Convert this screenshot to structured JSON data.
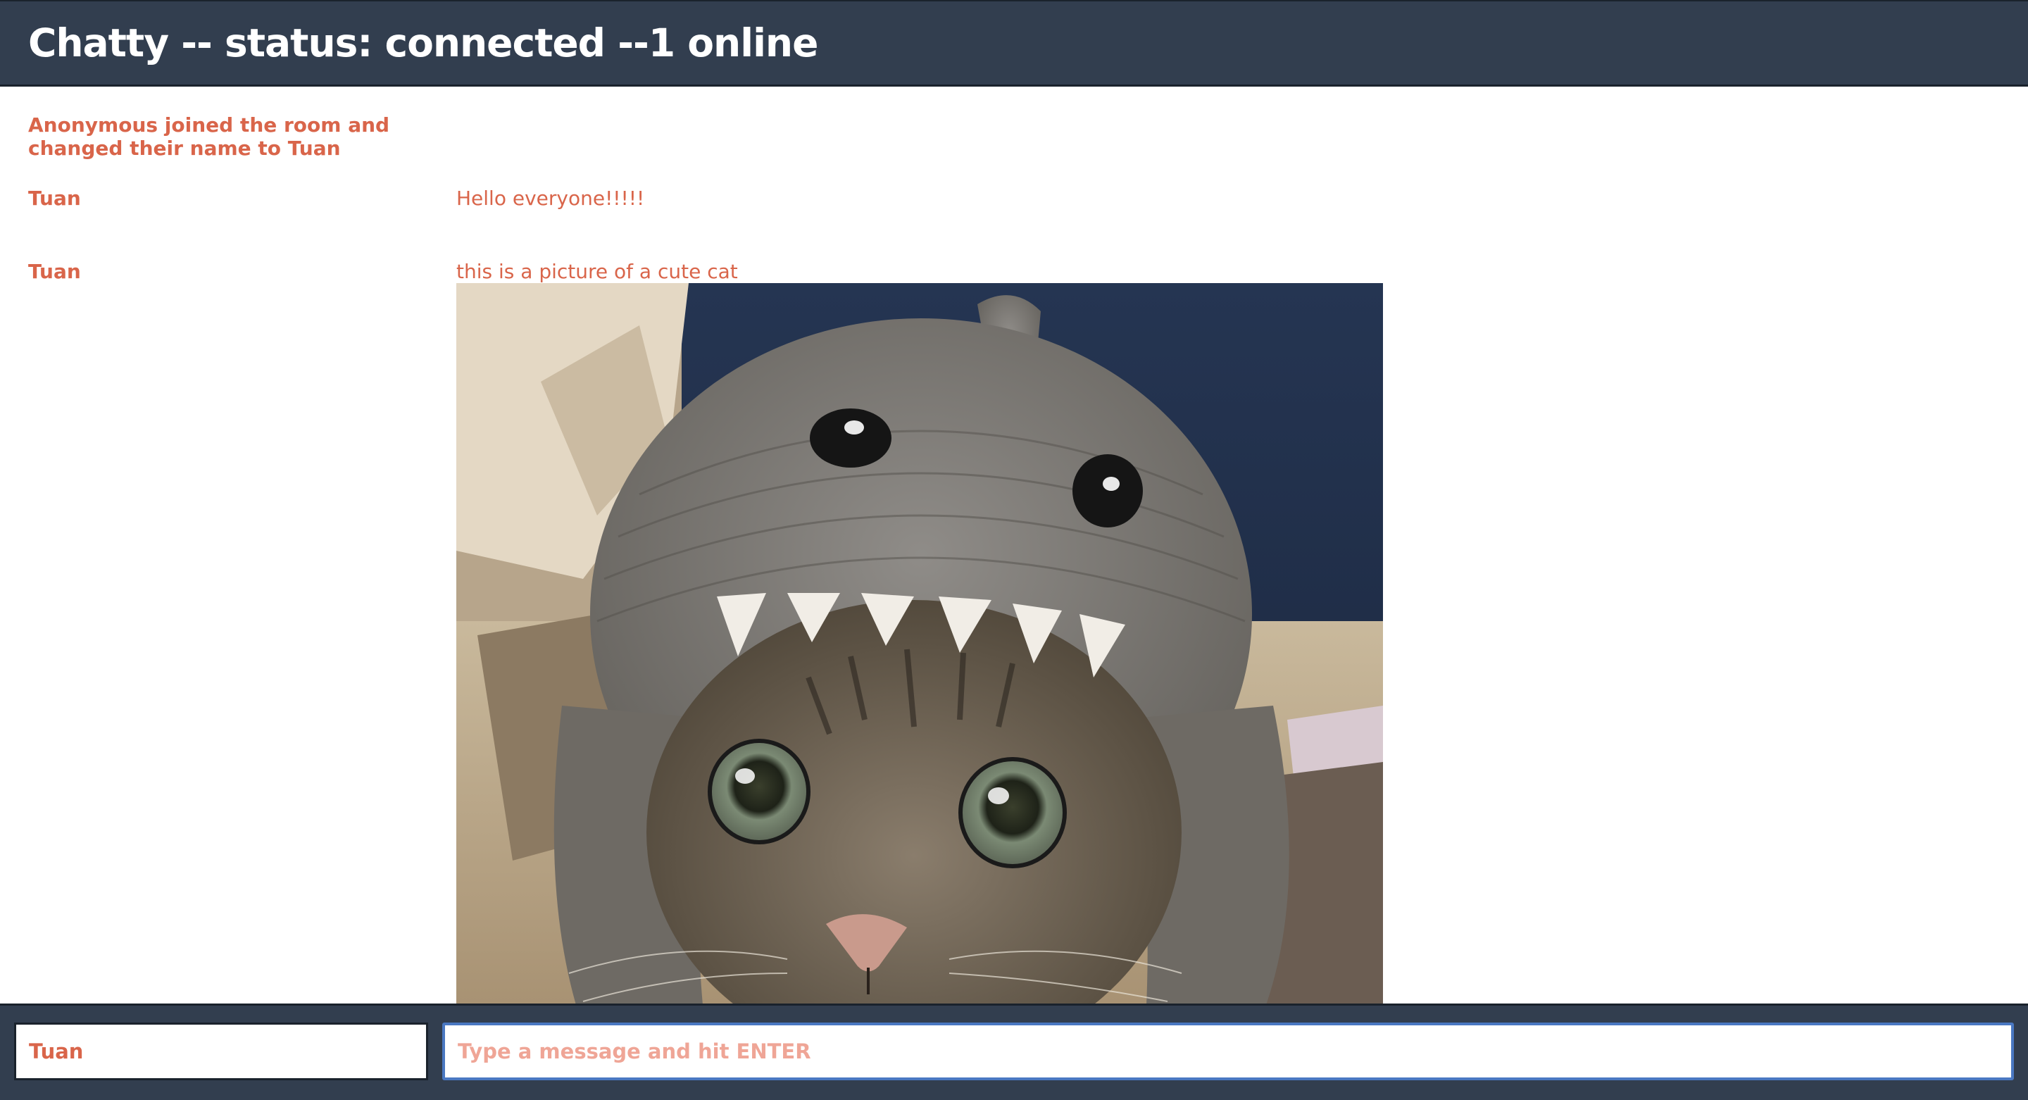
{
  "navbar": {
    "title": "Chatty -- status: connected --1 online"
  },
  "messages": {
    "notification": "Anonymous joined the room and changed their name to Tuan",
    "items": [
      {
        "username": "Tuan",
        "content": "Hello everyone!!!!!"
      },
      {
        "username": "Tuan",
        "content": "this is a picture of a cute cat"
      }
    ]
  },
  "chatbar": {
    "username_value": "Tuan",
    "message_placeholder": "Type a message and hit ENTER",
    "message_value": ""
  },
  "colors": {
    "navbar_bg": "#323e4f",
    "accent_text": "#d9654a",
    "input_focus_border": "#4a78c2"
  }
}
